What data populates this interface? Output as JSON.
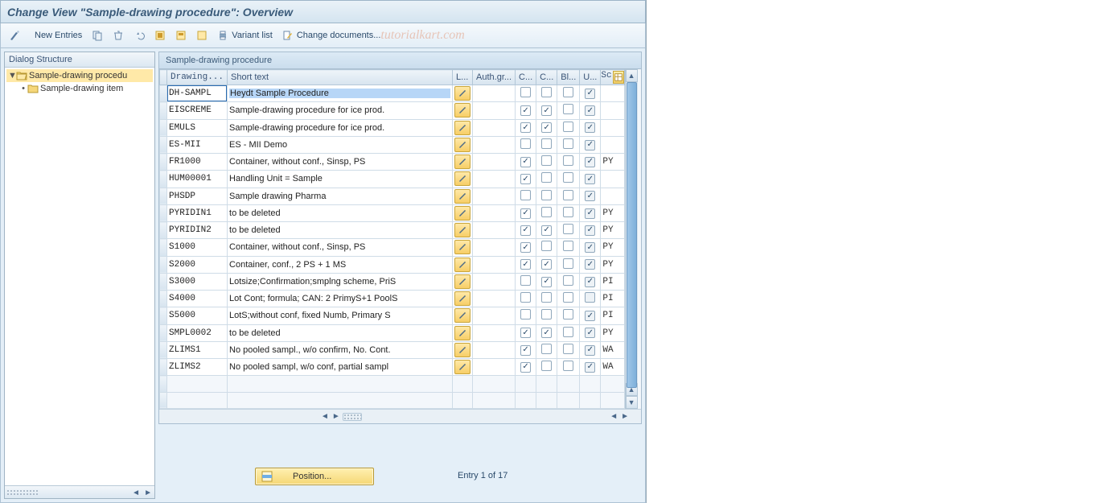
{
  "title": "Change View \"Sample-drawing procedure\": Overview",
  "toolbar": {
    "new_entries": "New Entries",
    "variant_list": "Variant list",
    "change_docs": "Change documents..."
  },
  "watermark": "tutorialkart.com",
  "sidebar": {
    "title": "Dialog Structure",
    "items": [
      {
        "label": "Sample-drawing procedu",
        "selected": true,
        "level": 0,
        "folder_open": true,
        "bullet": "▼"
      },
      {
        "label": "Sample-drawing item",
        "selected": false,
        "level": 1,
        "folder_open": false,
        "bullet": "•"
      }
    ]
  },
  "panel_title": "Sample-drawing procedure",
  "columns": {
    "drawing": "Drawing...",
    "short": "Short text",
    "lang": "L...",
    "auth": "Auth.gr...",
    "c1": "C...",
    "c2": "C...",
    "bl": "Bl...",
    "u": "U...",
    "sc": "Sc"
  },
  "rows": [
    {
      "drawing": "DH-SAMPL",
      "short": "Heydt Sample Procedure",
      "c1": false,
      "c2": false,
      "bl": false,
      "u": true,
      "sc": "",
      "sel": true
    },
    {
      "drawing": "EISCREME",
      "short": "Sample-drawing procedure for ice prod.",
      "c1": true,
      "c2": true,
      "bl": false,
      "u": true,
      "sc": "",
      "sel": false
    },
    {
      "drawing": "EMULS",
      "short": "Sample-drawing procedure for ice prod.",
      "c1": true,
      "c2": true,
      "bl": false,
      "u": true,
      "sc": "",
      "sel": false
    },
    {
      "drawing": "ES-MII",
      "short": "ES - MII Demo",
      "c1": false,
      "c2": false,
      "bl": false,
      "u": true,
      "sc": "",
      "sel": false
    },
    {
      "drawing": "FR1000",
      "short": "Container, without conf., Sinsp, PS",
      "c1": true,
      "c2": false,
      "bl": false,
      "u": true,
      "sc": "PY",
      "sel": false
    },
    {
      "drawing": "HUM00001",
      "short": "Handling Unit = Sample",
      "c1": true,
      "c2": false,
      "bl": false,
      "u": true,
      "sc": "",
      "sel": false
    },
    {
      "drawing": "PHSDP",
      "short": "Sample drawing Pharma",
      "c1": false,
      "c2": false,
      "bl": false,
      "u": true,
      "sc": "",
      "sel": false
    },
    {
      "drawing": "PYRIDIN1",
      "short": "to be deleted",
      "c1": true,
      "c2": false,
      "bl": false,
      "u": true,
      "sc": "PY",
      "sel": false
    },
    {
      "drawing": "PYRIDIN2",
      "short": "to be deleted",
      "c1": true,
      "c2": true,
      "bl": false,
      "u": true,
      "sc": "PY",
      "sel": false
    },
    {
      "drawing": "S1000",
      "short": "Container, without conf., Sinsp, PS",
      "c1": true,
      "c2": false,
      "bl": false,
      "u": true,
      "sc": "PY",
      "sel": false
    },
    {
      "drawing": "S2000",
      "short": "Container, conf., 2 PS + 1 MS",
      "c1": true,
      "c2": true,
      "bl": false,
      "u": true,
      "sc": "PY",
      "sel": false
    },
    {
      "drawing": "S3000",
      "short": "Lotsize;Confirmation;smplng scheme, PriS",
      "c1": false,
      "c2": true,
      "bl": false,
      "u": true,
      "sc": "PI",
      "sel": false
    },
    {
      "drawing": "S4000",
      "short": "Lot Cont; formula; CAN: 2 PrimyS+1 PoolS",
      "c1": false,
      "c2": false,
      "bl": false,
      "u": false,
      "sc": "PI",
      "sel": false
    },
    {
      "drawing": "S5000",
      "short": "LotS;without conf, fixed Numb, Primary S",
      "c1": false,
      "c2": false,
      "bl": false,
      "u": true,
      "sc": "PI",
      "sel": false
    },
    {
      "drawing": "SMPL0002",
      "short": "to be deleted",
      "c1": true,
      "c2": true,
      "bl": false,
      "u": true,
      "sc": "PY",
      "sel": false
    },
    {
      "drawing": "ZLIMS1",
      "short": "No pooled sampl., w/o confirm, No. Cont.",
      "c1": true,
      "c2": false,
      "bl": false,
      "u": true,
      "sc": "WA",
      "sel": false
    },
    {
      "drawing": "ZLIMS2",
      "short": "No pooled sampl, w/o conf, partial sampl",
      "c1": true,
      "c2": false,
      "bl": false,
      "u": true,
      "sc": "WA",
      "sel": false
    }
  ],
  "empty_rows": 2,
  "footer": {
    "position": "Position...",
    "entry": "Entry 1 of 17"
  }
}
